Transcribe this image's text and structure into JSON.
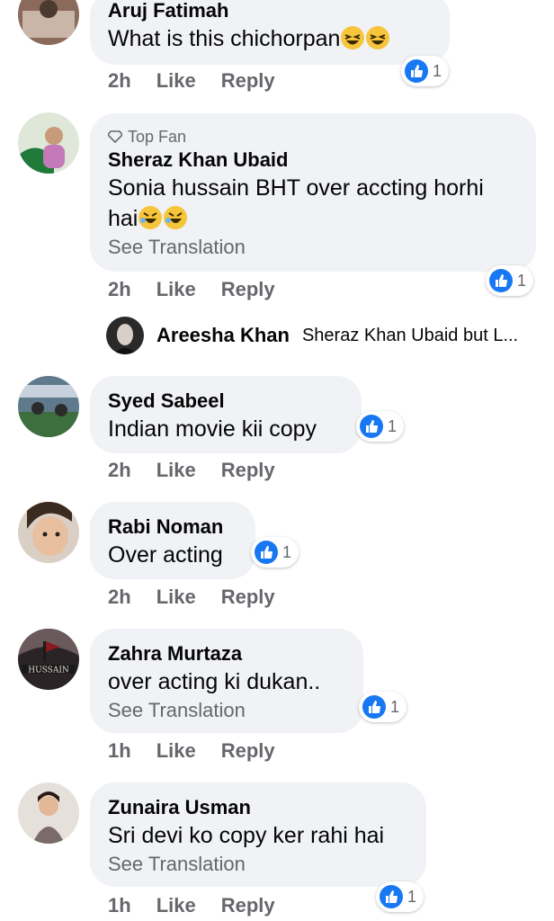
{
  "comments": [
    {
      "name": "Aruj Fatimah",
      "text": "What is this chichorpan",
      "time": "2h",
      "like": "Like",
      "reply": "Reply",
      "reactions": "1"
    },
    {
      "badge": "Top Fan",
      "name": "Sheraz Khan Ubaid",
      "text_line1": "Sonia hussain BHT over accting horhi",
      "text_line2": "hai",
      "see_translation": "See Translation",
      "time": "2h",
      "like": "Like",
      "reply": "Reply",
      "reactions": "1"
    },
    {
      "name": "Syed Sabeel",
      "text": "Indian movie kii copy",
      "time": "2h",
      "like": "Like",
      "reply": "Reply",
      "reactions": "1"
    },
    {
      "name": "Rabi Noman",
      "text": "Over acting",
      "time": "2h",
      "like": "Like",
      "reply": "Reply",
      "reactions": "1"
    },
    {
      "name": "Zahra Murtaza",
      "text": "over acting ki dukan..",
      "see_translation": "See Translation",
      "time": "1h",
      "like": "Like",
      "reply": "Reply",
      "reactions": "1"
    },
    {
      "name": "Zunaira Usman",
      "text": "Sri devi ko copy ker rahi hai",
      "see_translation": "See Translation",
      "time": "1h",
      "like": "Like",
      "reply": "Reply",
      "reactions": "1"
    }
  ],
  "reply_preview": {
    "name": "Areesha Khan",
    "text": "Sheraz Khan Ubaid but L..."
  },
  "colors": {
    "bubble": "#f0f2f5",
    "meta": "#65676b",
    "like_blue": "#1877f2"
  }
}
